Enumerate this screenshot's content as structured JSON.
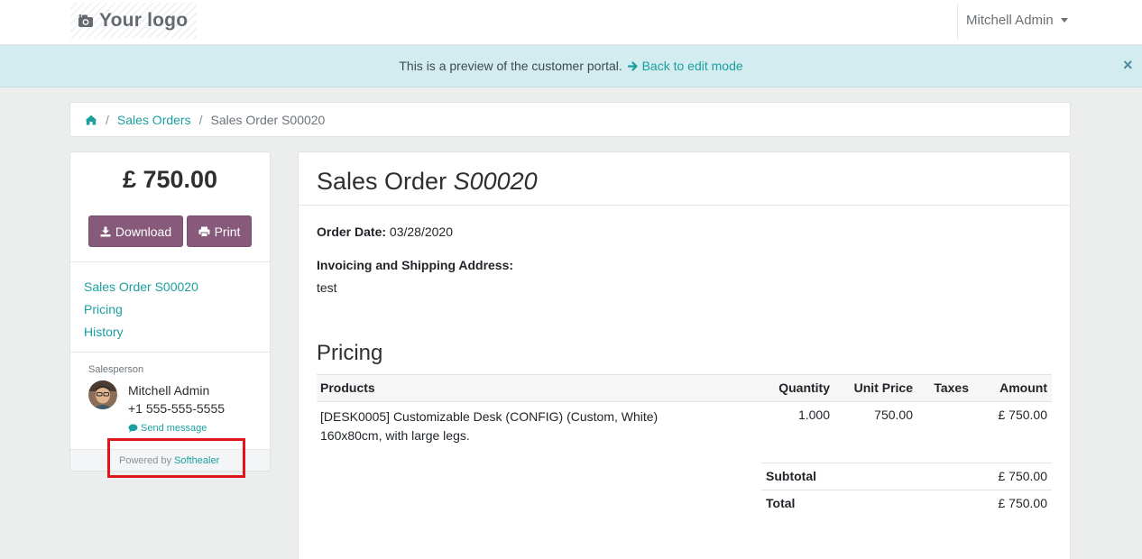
{
  "navbar": {
    "logo_text": "Your logo",
    "user_name": "Mitchell Admin"
  },
  "banner": {
    "message": "This is a preview of the customer portal.",
    "link_label": "Back to edit mode",
    "close_glyph": "×"
  },
  "breadcrumb": {
    "items": [
      {
        "label": "Sales Orders"
      },
      {
        "label": "Sales Order S00020"
      }
    ],
    "separator": "/"
  },
  "sidebar": {
    "amount": "£ 750.00",
    "download_label": "Download",
    "print_label": "Print",
    "toc": [
      {
        "label": "Sales Order S00020"
      },
      {
        "label": "Pricing"
      },
      {
        "label": "History"
      }
    ],
    "salesperson_label": "Salesperson",
    "salesperson_name": "Mitchell Admin",
    "salesperson_phone": "+1 555-555-5555",
    "send_message_label": "Send message",
    "powered_by_label": "Powered by",
    "powered_by_link": "Softhealer"
  },
  "order": {
    "title_prefix": "Sales Order",
    "title_number": "S00020",
    "order_date_label": "Order Date:",
    "order_date": "03/28/2020",
    "address_label": "Invoicing and Shipping Address:",
    "address": "test",
    "pricing_heading": "Pricing",
    "columns": [
      "Products",
      "Quantity",
      "Unit Price",
      "Taxes",
      "Amount"
    ],
    "lines": [
      {
        "product": "[DESK0005] Customizable Desk (CONFIG) (Custom, White) 160x80cm, with large legs.",
        "quantity": "1.000",
        "unit_price": "750.00",
        "taxes": "",
        "amount": "£ 750.00"
      }
    ],
    "subtotal_label": "Subtotal",
    "subtotal": "£ 750.00",
    "total_label": "Total",
    "total": "£ 750.00"
  },
  "colors": {
    "accent": "#1c9f9f",
    "button": "#875a7b",
    "banner_bg": "#d2ecef",
    "highlight": "#e0161c"
  }
}
